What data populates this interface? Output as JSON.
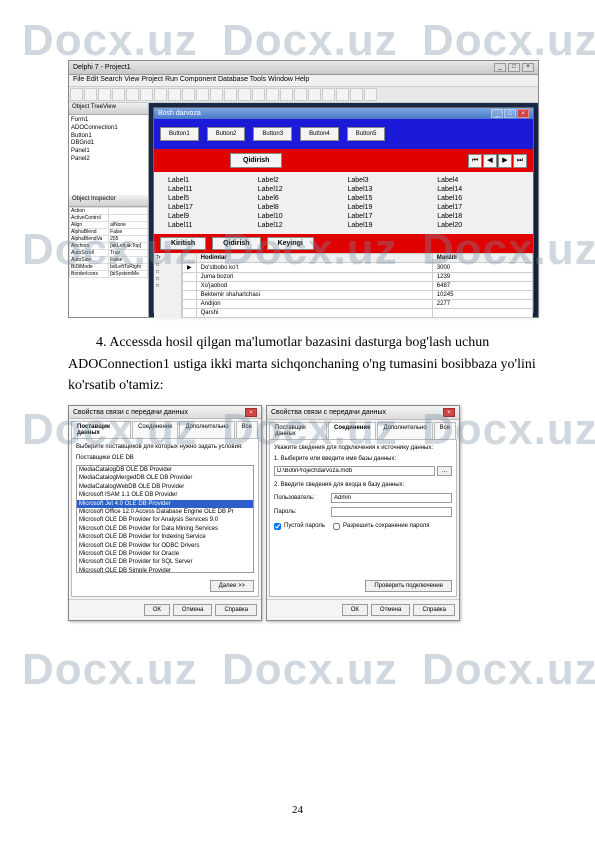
{
  "watermark": "Docx.uz",
  "ide": {
    "title": "Delphi 7 - Project1",
    "menu": "File  Edit  Search  View  Project  Run  Component  Database  Tools  Window  Help",
    "projectTree": {
      "header": "Object TreeView",
      "items": [
        "Form1",
        "  ADOConnection1",
        "  Button1",
        "  DBGrid1",
        "  Panel1",
        "  Panel2"
      ]
    },
    "inspector": {
      "header": "Object Inspector",
      "rows": [
        [
          "Action",
          ""
        ],
        [
          "ActiveControl",
          ""
        ],
        [
          "Align",
          "alNone"
        ],
        [
          "AlphaBlend",
          "False"
        ],
        [
          "AlphaBlendVa",
          "255"
        ],
        [
          "Anchors",
          "[akLeft,akTop]"
        ],
        [
          "AutoScroll",
          "True"
        ],
        [
          "AutoSize",
          "False"
        ],
        [
          "BiDiMode",
          "bdLeftToRight"
        ],
        [
          "BorderIcons",
          "[biSystemMe"
        ]
      ]
    },
    "form": {
      "title": "Bosh darvoza",
      "topButtons": [
        "Button1",
        "Button2",
        "Button3",
        "Button4",
        "Button5"
      ],
      "red1Button": "Qidirish",
      "labels": [
        [
          "Label1",
          "Label2",
          "Label3",
          "Label4"
        ],
        [
          "Label11",
          "Label12",
          "Label13",
          "Label14"
        ],
        [
          "Label5",
          "Label6",
          "Label15",
          "Label16"
        ],
        [
          "Label17",
          "Label8",
          "Label19",
          "Label17"
        ],
        [
          "Label9",
          "Label10",
          "Label17",
          "Label18"
        ],
        [
          "Label11",
          "Label12",
          "Label19",
          "Label20"
        ]
      ],
      "red2Buttons": [
        "Kiritish",
        "Qidirish",
        "Keyingi"
      ],
      "gridHeaderCols": [
        "Hodimlar",
        "Manzili"
      ],
      "gridRows": [
        [
          "",
          "Do'stbobo ko't",
          "3000"
        ],
        [
          "",
          "Juma bozori",
          "1239"
        ],
        [
          "",
          "Xo'jaobod",
          "6487"
        ],
        [
          "",
          "Bektemir shahartchasi",
          "10245"
        ],
        [
          "",
          "Andijon",
          "2277"
        ],
        [
          "",
          "Qarshi",
          ""
        ]
      ]
    }
  },
  "paragraph": {
    "line1": "4.  Accessda  hosil  qilgan  ma'lumotlar  bazasini  dasturga  bog'lash  uchun",
    "line2": "ADOConnection1 ustiga ikki marta sichqonchaning o'ng tumasini bosibbaza yo'lini",
    "line3": "ko'rsatib o'tamiz:"
  },
  "dlg1": {
    "title": "Свойства связи с передачи данных",
    "tabs": [
      "Поставщик данных",
      "Соединение",
      "Дополнительно",
      "Все"
    ],
    "prompt": "Выберите поставщиков для которых нужно задать условия:",
    "listHeader": "Поставщики OLE DB",
    "providers": [
      "MediaCatalogDB OLE DB Provider",
      "MediaCatalogMergedDB OLE DB Provider",
      "MediaCatalogWebDB OLE DB Provider",
      "Microsoft ISAM 1.1 OLE DB Provider",
      "Microsoft Jet 4.0 OLE DB Provider",
      "Microsoft Office 12.0 Access Database Engine OLE DB Pr",
      "Microsoft OLE DB Provider for Analysis Services 9.0",
      "Microsoft OLE DB Provider for Data Mining Services",
      "Microsoft OLE DB Provider for Indexing Service",
      "Microsoft OLE DB Provider for ODBC Drivers",
      "Microsoft OLE DB Provider for Oracle",
      "Microsoft OLE DB Provider for SQL Server",
      "Microsoft OLE DB Simple Provider"
    ],
    "selectedIndex": 4,
    "nextBtn": "Далее >>",
    "ok": "ОК",
    "cancel": "Отмена",
    "help": "Справка"
  },
  "dlg2": {
    "title": "Свойства связи с передачи данных",
    "tabs": [
      "Поставщик данных",
      "Соединение",
      "Дополнительно",
      "Все"
    ],
    "prompt": "Укажите сведения для подключения к источнику данных:",
    "item1": "1. Выберите или введите имя базы данных:",
    "dbPath": "D:\\BotirProject\\darvoza.mdb",
    "item2": "2. Введите сведения для входа в базу данных:",
    "userLabel": "Пользователь:",
    "userValue": "Admin",
    "passLabel": "Пароль:",
    "chkBlank": "Пустой пароль",
    "chkSave": "Разрешить сохранение пароля",
    "testBtn": "Проверить подключение",
    "ok": "ОК",
    "cancel": "Отмена",
    "help": "Справка"
  },
  "pageNumber": "24"
}
